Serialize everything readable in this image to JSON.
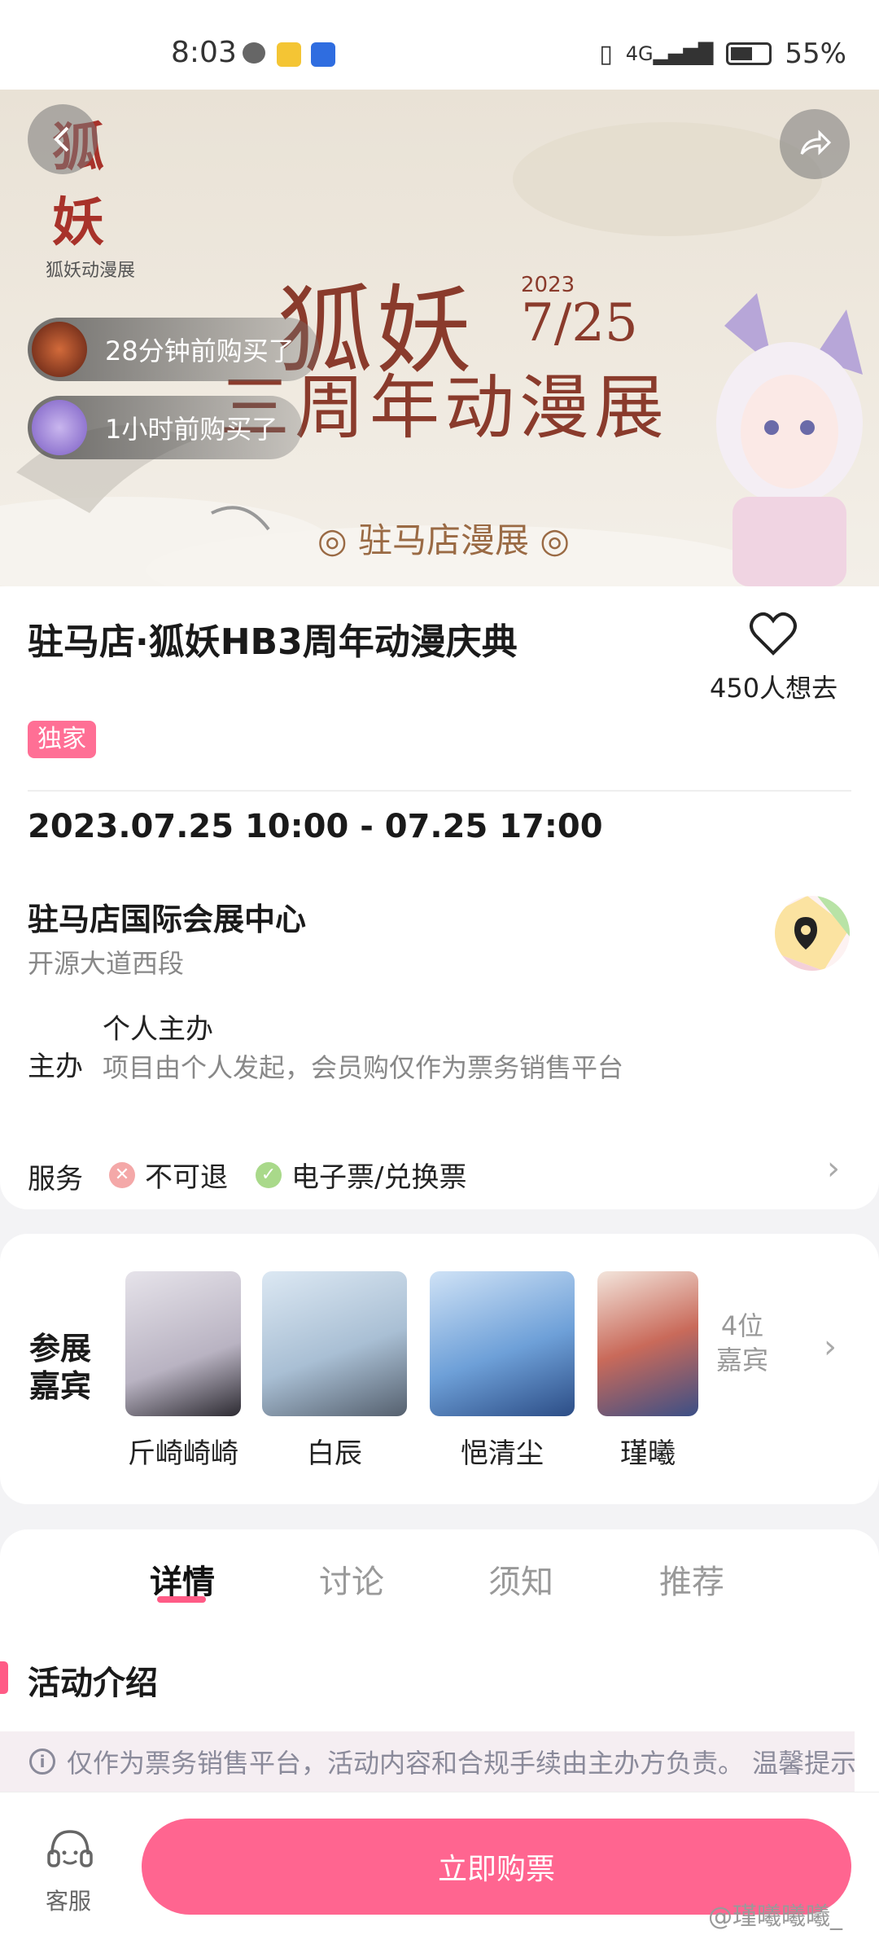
{
  "status_bar": {
    "time": "8:03",
    "battery": "55%",
    "network": "4G"
  },
  "banner": {
    "logo_text": "狐妖",
    "logo_sub": "狐妖动漫展",
    "title_line1": "狐妖",
    "title_line2": "三周年动漫展",
    "year": "2023",
    "date": "7/25",
    "subtitle": "◎ 驻马店漫展 ◎",
    "recent_buyers": [
      {
        "text": "28分钟前购买了"
      },
      {
        "text": "1小时前购买了"
      }
    ]
  },
  "event": {
    "title": "驻马店·狐妖HB3周年动漫庆典",
    "wish_count": "450人想去",
    "tag": "独家",
    "datetime": "2023.07.25 10:00 - 07.25 17:00",
    "venue": "驻马店国际会展中心",
    "address": "开源大道西段",
    "organizer_label": "主办",
    "organizer_name": "个人主办",
    "organizer_desc": "项目由个人发起，会员购仅作为票务销售平台",
    "service_label": "服务",
    "services": [
      {
        "text": "不可退",
        "status": "no"
      },
      {
        "text": "电子票/兑换票",
        "status": "yes"
      }
    ]
  },
  "guests": {
    "label_line1": "参展",
    "label_line2": "嘉宾",
    "items": [
      {
        "name": "斤崎崎崎"
      },
      {
        "name": "白辰"
      },
      {
        "name": "悒清尘"
      },
      {
        "name": "瑾曦"
      }
    ],
    "more_line1": "4位",
    "more_line2": "嘉宾"
  },
  "tabs": [
    {
      "label": "详情",
      "active": true
    },
    {
      "label": "讨论",
      "active": false
    },
    {
      "label": "须知",
      "active": false
    },
    {
      "label": "推荐",
      "active": false
    }
  ],
  "section": {
    "title": "活动介绍",
    "notice": "仅作为票务销售平台，活动内容和合规手续由主办方负责。 温馨提示"
  },
  "bottom": {
    "service": "客服",
    "buy": "立即购票",
    "watermark": "@瑾曦曦曦_"
  },
  "colors": {
    "accent": "#ff6590",
    "tag": "#ff6f95",
    "banner_text": "#8a3b2c"
  }
}
